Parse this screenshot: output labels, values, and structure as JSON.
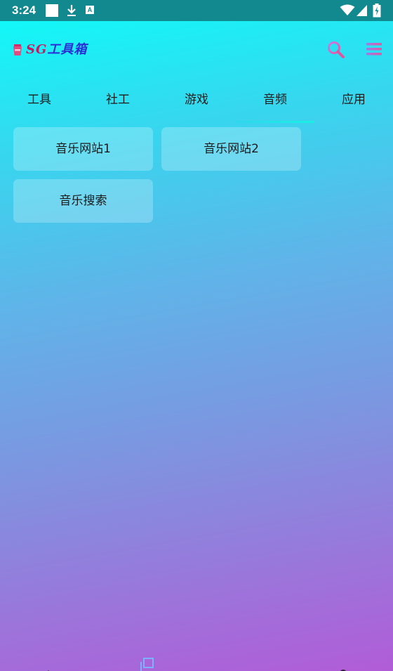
{
  "status_bar": {
    "time": "3:24",
    "icons": [
      "square-icon",
      "download-icon",
      "a-badge-icon",
      "wifi-icon",
      "signal-icon",
      "battery-icon"
    ],
    "a_badge": "A"
  },
  "app_bar": {
    "title_part1": "SG",
    "title_part2": "工具箱",
    "logo_icon": "cup-logo-icon",
    "search_icon": "search-icon",
    "menu_icon": "menu-icon"
  },
  "tabs": [
    {
      "label": "工具"
    },
    {
      "label": "社工"
    },
    {
      "label": "游戏"
    },
    {
      "label": "音频"
    },
    {
      "label": "应用"
    }
  ],
  "selected_tab_index": 3,
  "cards": [
    {
      "label": "音乐网站1"
    },
    {
      "label": "音乐网站2"
    },
    {
      "label": "音乐搜索"
    }
  ],
  "colors": {
    "status_bar_bg": "#12898f",
    "gradient_top": "#0cfdf9",
    "gradient_bottom": "#b15cd7",
    "tab_indicator": "#19f0e4",
    "title_red": "#c81a5e",
    "title_blue": "#2b2dd6"
  },
  "nav_bar": {
    "icons": [
      "home-icon",
      "recent-apps-icon",
      "back-icon",
      "assistant-dot-icon"
    ]
  }
}
